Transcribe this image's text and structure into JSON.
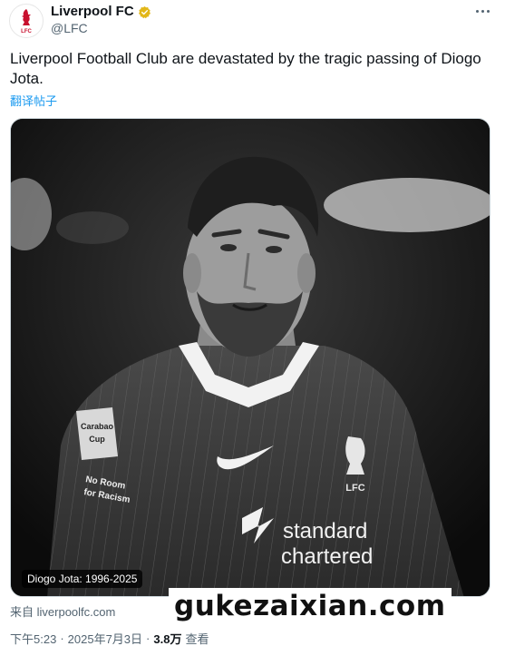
{
  "author": {
    "display_name": "Liverpool FC",
    "handle": "@LFC",
    "avatar_text": "LFC"
  },
  "tweet": {
    "text": "Liverpool Football Club are devastated by the tragic passing of Diogo Jota.",
    "translate_label": "翻译帖子"
  },
  "media": {
    "caption": "Diogo Jota: 1996-2025",
    "shirt_sponsor": [
      "standard",
      "chartered"
    ],
    "badge_text": "LFC",
    "sleeve_patch": [
      "Carabao",
      "Cup"
    ],
    "sleeve_text": [
      "No Room",
      "for Racism"
    ]
  },
  "source": {
    "prefix": "来自",
    "domain": "liverpoolfc.com"
  },
  "watermark": "gukezaixian.com",
  "meta": {
    "time": "下午5:23",
    "date": "2025年7月3日",
    "views": "3.8万",
    "views_suffix": "查看",
    "separator": "·"
  },
  "colors": {
    "brand_red": "#c8102e",
    "verified_gold": "#e2b719",
    "link_blue": "#1d9bf0",
    "secondary_text": "#536471"
  }
}
